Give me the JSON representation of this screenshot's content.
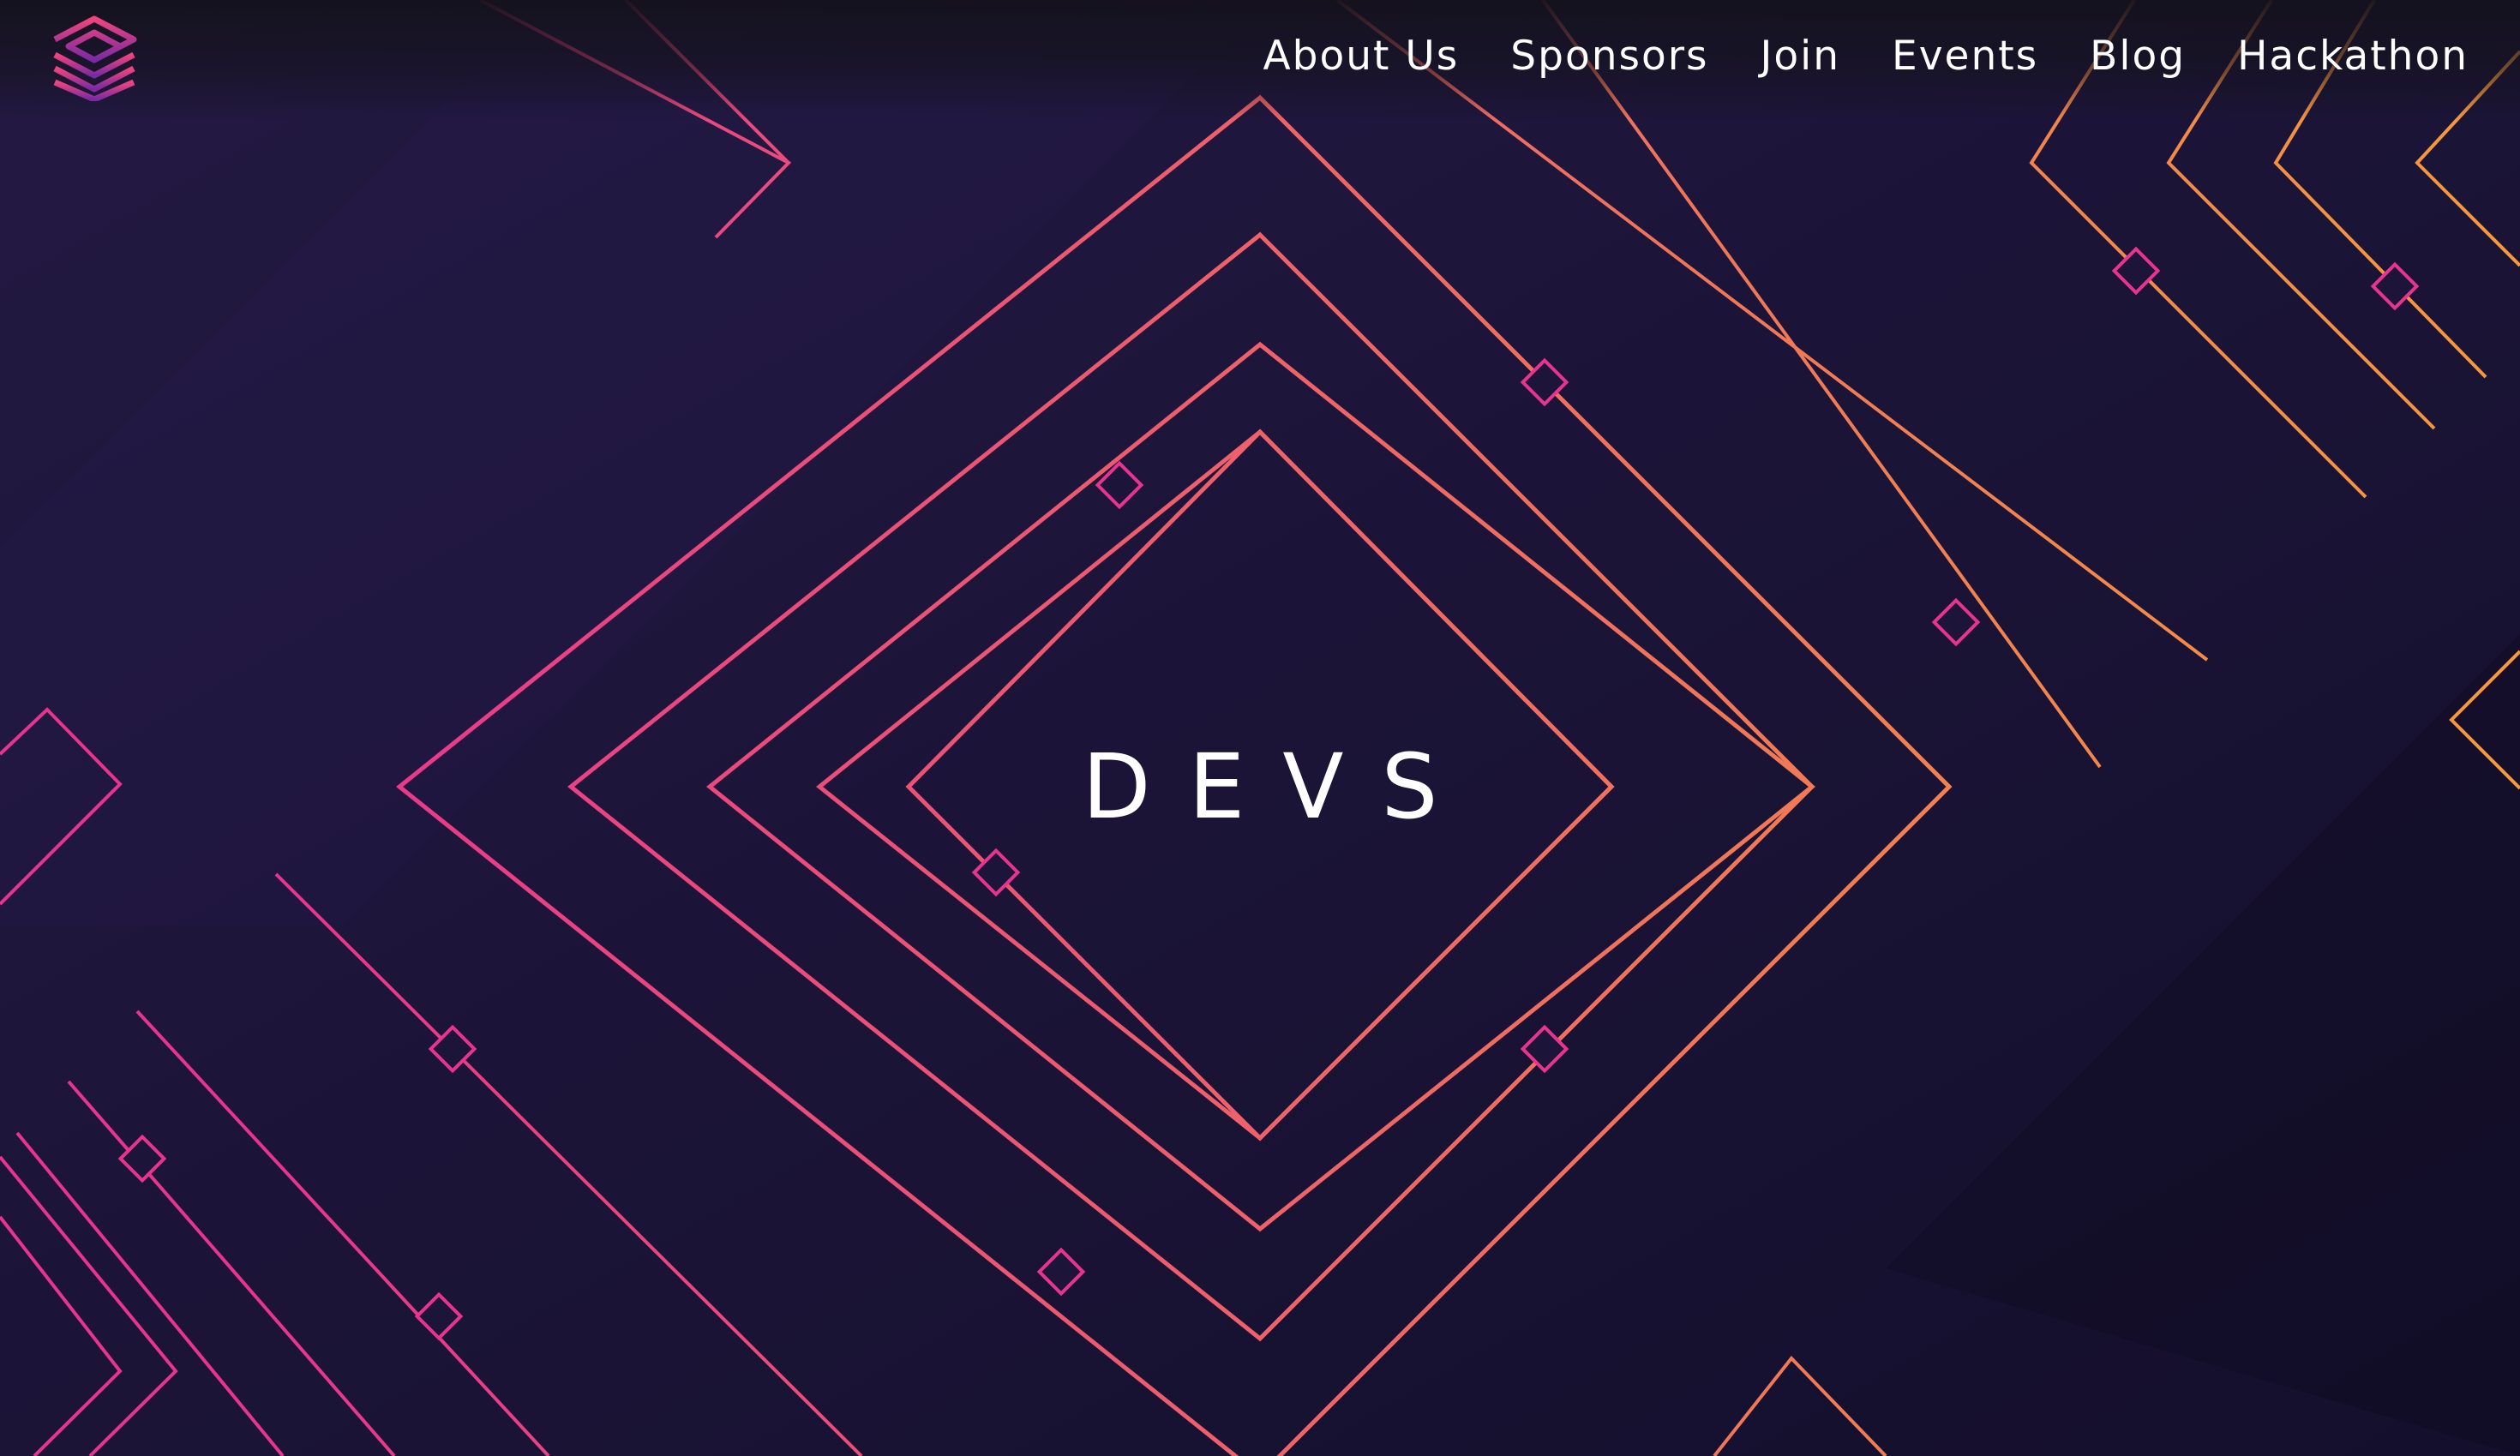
{
  "nav": {
    "items": [
      {
        "label": "About Us"
      },
      {
        "label": "Sponsors"
      },
      {
        "label": "Join"
      },
      {
        "label": "Events"
      },
      {
        "label": "Blog"
      },
      {
        "label": "Hackathon"
      }
    ]
  },
  "hero": {
    "title": "DEVS"
  },
  "icons": {
    "logo": "stacked-layers-logo-icon"
  },
  "colors": {
    "background": "#1c1539",
    "gradient_pink": "#e8338f",
    "gradient_orange": "#f5993c",
    "text": "#ffffff"
  }
}
